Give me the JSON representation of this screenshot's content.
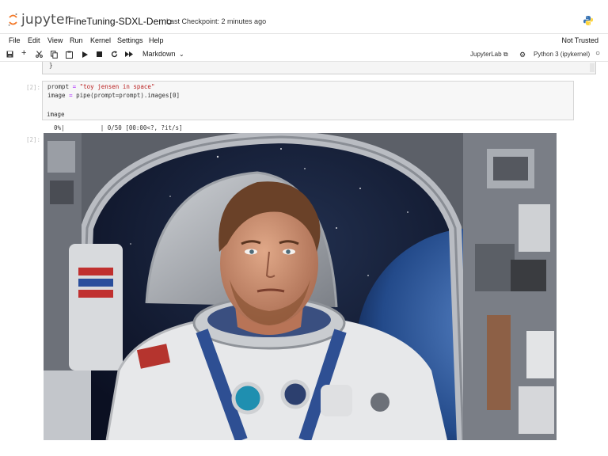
{
  "header": {
    "logo_text": "jupyter",
    "notebook_name": "FineTuning-SDXL-Demo",
    "checkpoint": "Last Checkpoint: 2 minutes ago"
  },
  "menu": {
    "items": [
      "File",
      "Edit",
      "View",
      "Run",
      "Kernel",
      "Settings",
      "Help"
    ],
    "trusted": "Not Trusted"
  },
  "toolbar": {
    "cell_type": "Markdown",
    "jupyterlab_label": "JupyterLab",
    "kernel": "Python 3 (ipykernel)"
  },
  "notebook": {
    "prev_cell_tail": "}",
    "cell2_prompt": "[2]:",
    "cell2_line1_a": "prompt ",
    "cell2_line1_op": "=",
    "cell2_line1_str": " \"toy jensen in space\"",
    "cell2_line2_a": "image ",
    "cell2_line2_op": "=",
    "cell2_line2_b": " pipe(prompt=prompt).images[0]",
    "cell2_line3": "image",
    "progress": "  0%|          | 0/50 [00:00<?, ?it/s]",
    "out_prompt": "[2]:"
  },
  "colors": {
    "jupyter_orange": "#f37726",
    "string_red": "#ba2121",
    "operator_purple": "#aa22ff"
  }
}
